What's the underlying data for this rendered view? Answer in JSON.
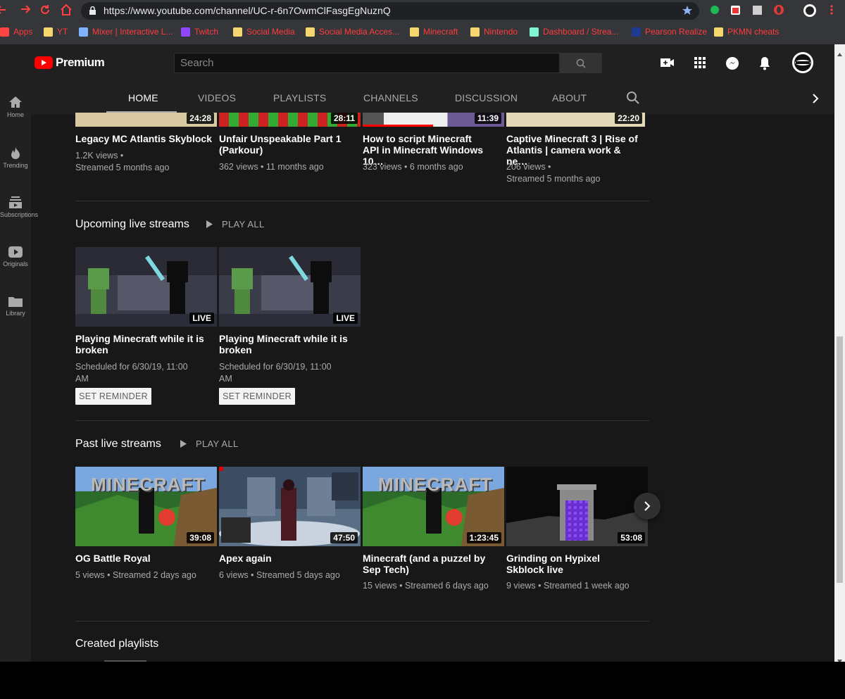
{
  "browser": {
    "url": "https://www.youtube.com/channel/UC-r-6n7OwmClFasgEgNuznQ",
    "bookmarks": [
      {
        "label": "Apps",
        "icon": "apps-grid-icon",
        "color": "#ff4444"
      },
      {
        "label": "YT",
        "icon": "folder-icon",
        "color": "#f5d76e"
      },
      {
        "label": "Mixer | Interactive L...",
        "icon": "mixer-icon",
        "color": "#7fb2ff"
      },
      {
        "label": "Twitch",
        "icon": "twitch-icon",
        "color": "#9146ff"
      },
      {
        "label": "Social Media",
        "icon": "folder-icon",
        "color": "#f5d76e"
      },
      {
        "label": "Social Media Acces...",
        "icon": "folder-icon",
        "color": "#f5d76e"
      },
      {
        "label": "Minecraft",
        "icon": "folder-icon",
        "color": "#f5d76e"
      },
      {
        "label": "Nintendo",
        "icon": "folder-icon",
        "color": "#f5d76e"
      },
      {
        "label": "Dashboard / Strea...",
        "icon": "streamlabs-icon",
        "color": "#80f5d2"
      },
      {
        "label": "Pearson Realize",
        "icon": "pearson-icon",
        "color": "#1f3a93"
      },
      {
        "label": "PKMN cheats",
        "icon": "folder-icon",
        "color": "#f5d76e"
      }
    ]
  },
  "masthead": {
    "logo_text": "Premium",
    "search_placeholder": "Search"
  },
  "channel_tabs": [
    "HOME",
    "VIDEOS",
    "PLAYLISTS",
    "CHANNELS",
    "DISCUSSION",
    "ABOUT"
  ],
  "sidebar": [
    {
      "label": "Home",
      "icon": "home-icon"
    },
    {
      "label": "Trending",
      "icon": "flame-icon"
    },
    {
      "label": "Subscriptions",
      "icon": "subscriptions-icon"
    },
    {
      "label": "Originals",
      "icon": "play-badge-icon"
    },
    {
      "label": "Library",
      "icon": "folder-icon"
    }
  ],
  "top_videos": [
    {
      "duration": "24:28",
      "title": "Legacy MC Atlantis Skyblock",
      "meta1": "1.2K views •",
      "meta2": "Streamed 5 months ago"
    },
    {
      "duration": "28:11",
      "title": "Unfair Unspeakable Part 1 (Parkour)",
      "meta1": "362 views • 11 months ago",
      "meta2": ""
    },
    {
      "duration": "11:39",
      "title": "How to script Minecraft API in Minecraft Windows 10…",
      "meta1": "323 views • 6 months ago",
      "meta2": ""
    },
    {
      "duration": "22:20",
      "title": "Captive Minecraft 3 | Rise of Atlantis | camera work & ne…",
      "meta1": "206 views •",
      "meta2": "Streamed 5 months ago"
    }
  ],
  "upcoming": {
    "title": "Upcoming live streams",
    "play_all": "PLAY ALL",
    "items": [
      {
        "badge": "LIVE",
        "title": "Playing Minecraft while it is broken",
        "meta": "Scheduled for 6/30/19, 11:00 AM",
        "button": "SET REMINDER"
      },
      {
        "badge": "LIVE",
        "title": "Playing Minecraft while it is broken",
        "meta": "Scheduled for 6/30/19, 11:00 AM",
        "button": "SET REMINDER"
      }
    ]
  },
  "past": {
    "title": "Past live streams",
    "play_all": "PLAY ALL",
    "items": [
      {
        "duration": "39:08",
        "title": "OG Battle Royal",
        "meta": "5 views • Streamed 2 days ago",
        "logo": "MINECRAFT"
      },
      {
        "duration": "47:50",
        "title": "Apex again",
        "meta": "6 views • Streamed 5 days ago",
        "logo": ""
      },
      {
        "duration": "1:23:45",
        "title": "Minecraft (and a puzzel by Sep Tech)",
        "meta": "15 views • Streamed 6 days ago",
        "logo": "MINECRAFT"
      },
      {
        "duration": "53:08",
        "title": "Grinding on Hypixel Skblock live",
        "meta": "9 views • Streamed 1 week ago",
        "logo": ""
      }
    ]
  },
  "created_playlists": {
    "title": "Created playlists"
  },
  "colors": {
    "yt_red": "#ff0000",
    "bg": "#181818",
    "masthead": "#202020",
    "muted": "#aaaaaa"
  }
}
